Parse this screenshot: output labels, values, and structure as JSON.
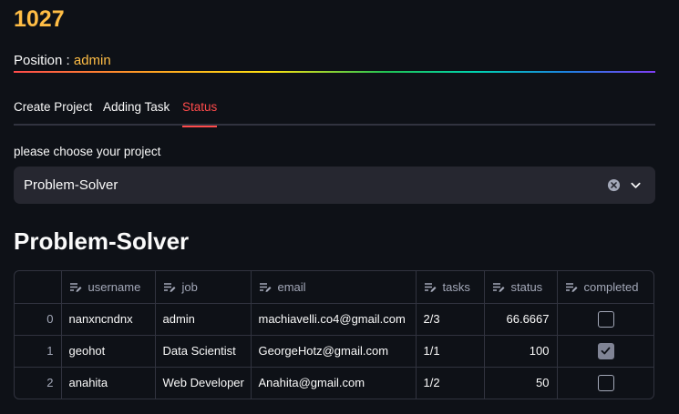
{
  "header": {
    "title": "1027",
    "position_label": "Position : ",
    "position_value": "admin"
  },
  "tabs": [
    {
      "label": "Create Project",
      "active": false
    },
    {
      "label": "Adding Task",
      "active": false
    },
    {
      "label": "Status",
      "active": true
    }
  ],
  "project_select": {
    "label": "please choose your project",
    "value": "Problem-Solver",
    "clear_icon": "clear-circle-icon",
    "chevron_icon": "chevron-down-icon"
  },
  "section_title": "Problem-Solver",
  "table": {
    "header_icon": "edit-column-icon",
    "columns": [
      "",
      "username",
      "job",
      "email",
      "tasks",
      "status",
      "completed"
    ],
    "rows": [
      {
        "index": "0",
        "username": "nanxncndnx",
        "job": "admin",
        "email": "machiavelli.co4@gmail.com",
        "tasks": "2/3",
        "status": "66.6667",
        "completed": false
      },
      {
        "index": "1",
        "username": "geohot",
        "job": "Data Scientist",
        "email": "GeorgeHotz@gmail.com",
        "tasks": "1/1",
        "status": "100",
        "completed": true
      },
      {
        "index": "2",
        "username": "anahita",
        "job": "Web Developer",
        "email": "Anahita@gmail.com",
        "tasks": "1/2",
        "status": "50",
        "completed": false
      }
    ]
  },
  "colors": {
    "accent": "#ff4b4b",
    "title": "#ffbd45",
    "background": "#0e1117",
    "input_bg": "#262730"
  }
}
